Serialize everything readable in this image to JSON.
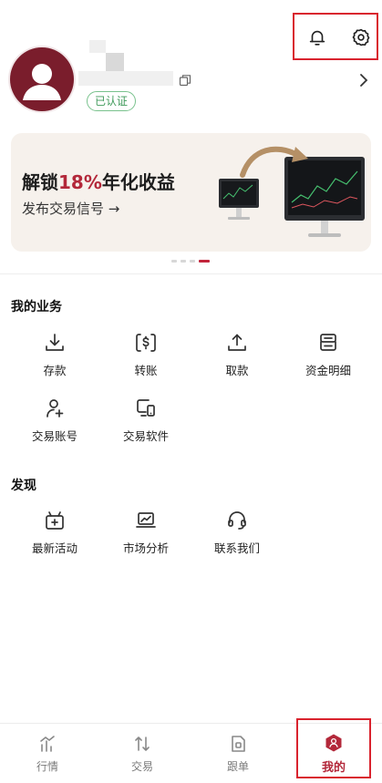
{
  "profile": {
    "verified_badge": "已认证"
  },
  "banner": {
    "line1_prefix": "解锁",
    "line1_accent": "18%",
    "line1_suffix": "年化收益",
    "line2": "发布交易信号 →"
  },
  "my_business": {
    "title": "我的业务",
    "items": [
      {
        "label": "存款",
        "icon": "download-icon"
      },
      {
        "label": "转账",
        "icon": "dollar-transfer-icon"
      },
      {
        "label": "取款",
        "icon": "upload-icon"
      },
      {
        "label": "资金明细",
        "icon": "ledger-icon"
      },
      {
        "label": "交易账号",
        "icon": "add-user-icon"
      },
      {
        "label": "交易软件",
        "icon": "devices-icon"
      }
    ]
  },
  "discover": {
    "title": "发现",
    "items": [
      {
        "label": "最新活动",
        "icon": "gift-box-icon"
      },
      {
        "label": "市场分析",
        "icon": "laptop-chart-icon"
      },
      {
        "label": "联系我们",
        "icon": "headset-icon"
      }
    ]
  },
  "bottom_nav": {
    "items": [
      {
        "label": "行情",
        "icon": "market-chart-icon"
      },
      {
        "label": "交易",
        "icon": "swap-arrows-icon"
      },
      {
        "label": "跟单",
        "icon": "copy-order-icon"
      },
      {
        "label": "我的",
        "icon": "profile-hex-icon"
      }
    ],
    "active": "我的"
  },
  "colors": {
    "accent": "#b3283a",
    "highlight_border": "#d9232e",
    "verified_green": "#3f9a5a",
    "banner_bg": "#f6f1ec"
  }
}
